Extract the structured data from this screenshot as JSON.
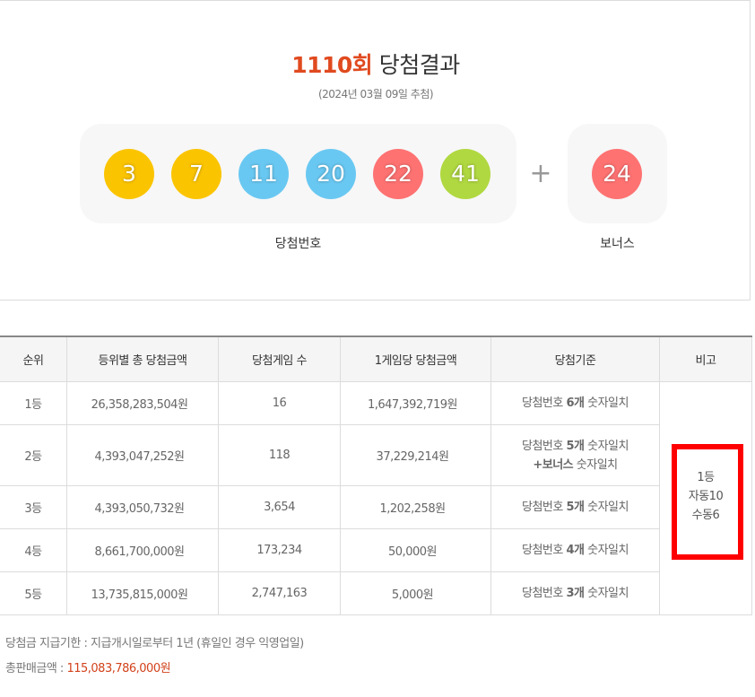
{
  "header": {
    "round": "1110회",
    "title_suffix": "당첨결과",
    "draw_date": "(2024년 03월 09일 추첨)"
  },
  "winning_numbers": {
    "label": "당첨번호",
    "balls": [
      {
        "number": "3",
        "color": "#fbc400"
      },
      {
        "number": "7",
        "color": "#fbc400"
      },
      {
        "number": "11",
        "color": "#69c8f2"
      },
      {
        "number": "20",
        "color": "#69c8f2"
      },
      {
        "number": "22",
        "color": "#ff7272"
      },
      {
        "number": "41",
        "color": "#b0d840"
      }
    ],
    "plus": "+",
    "bonus_label": "보너스",
    "bonus_ball": {
      "number": "24",
      "color": "#ff7272"
    }
  },
  "table": {
    "headers": [
      "순위",
      "등위별 총 당첨금액",
      "당첨게임 수",
      "1게임당 당첨금액",
      "당첨기준",
      "비고"
    ],
    "rows": [
      {
        "rank": "1등",
        "total": "26,358,283,504원",
        "games": "16",
        "per_game": "1,647,392,719원",
        "criteria_pre": "당첨번호 ",
        "criteria_count": "6개",
        "criteria_post": " 숫자일치",
        "criteria_line2": ""
      },
      {
        "rank": "2등",
        "total": "4,393,047,252원",
        "games": "118",
        "per_game": "37,229,214원",
        "criteria_pre": "당첨번호 ",
        "criteria_count": "5개",
        "criteria_post": " 숫자일치",
        "criteria_line2_bold": "+보너스",
        "criteria_line2": " 숫자일치"
      },
      {
        "rank": "3등",
        "total": "4,393,050,732원",
        "games": "3,654",
        "per_game": "1,202,258원",
        "criteria_pre": "당첨번호 ",
        "criteria_count": "5개",
        "criteria_post": " 숫자일치",
        "criteria_line2": ""
      },
      {
        "rank": "4등",
        "total": "8,661,700,000원",
        "games": "173,234",
        "per_game": "50,000원",
        "criteria_pre": "당첨번호 ",
        "criteria_count": "4개",
        "criteria_post": " 숫자일치",
        "criteria_line2": ""
      },
      {
        "rank": "5등",
        "total": "13,735,815,000원",
        "games": "2,747,163",
        "per_game": "5,000원",
        "criteria_pre": "당첨번호 ",
        "criteria_count": "3개",
        "criteria_post": " 숫자일치",
        "criteria_line2": ""
      }
    ],
    "note_lines": [
      "1등",
      "자동10",
      "수동6"
    ]
  },
  "footer": {
    "deadline_label": "당첨금 지급기한 : 지급개시일로부터 1년 (휴일인 경우 익영업일)",
    "sales_label": "총판매금액 : ",
    "sales_amount": "115,083,786,000원"
  },
  "colors": {
    "accent": "#e04a1f",
    "highlight_box": "#ff0000"
  }
}
